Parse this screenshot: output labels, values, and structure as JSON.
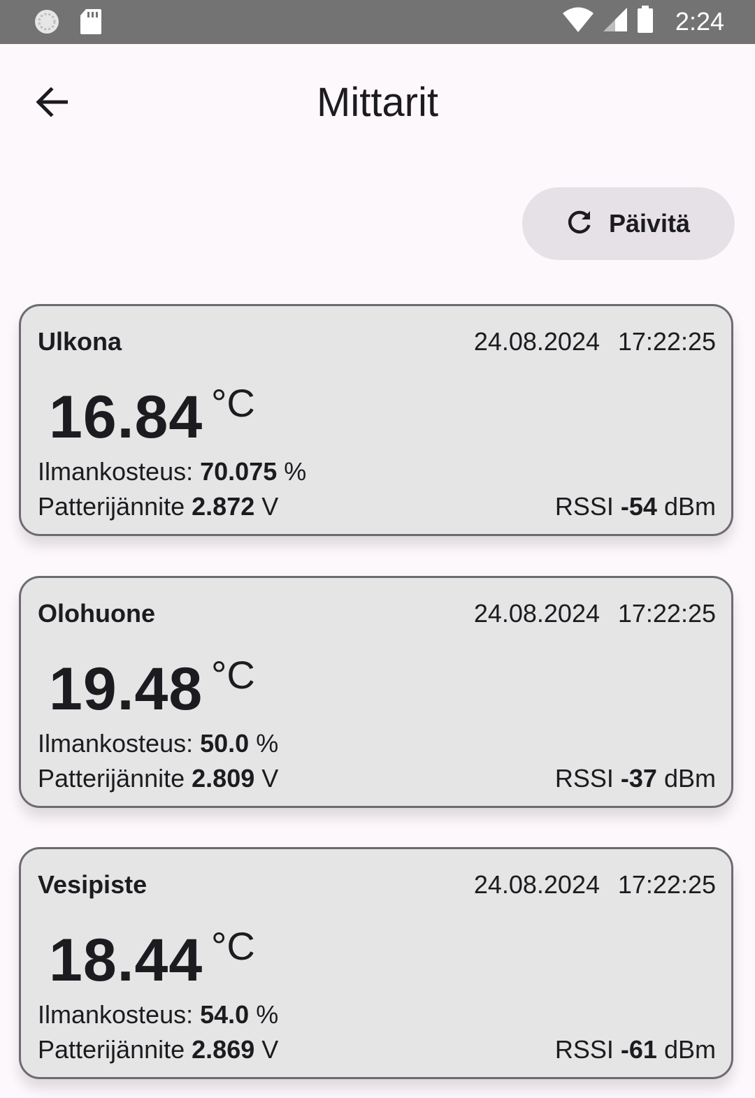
{
  "status_bar": {
    "time": "2:24",
    "icons": [
      "sync-icon",
      "sd-card-icon",
      "wifi-icon",
      "cell-signal-icon",
      "battery-icon"
    ]
  },
  "app_bar": {
    "title": "Mittarit",
    "back_icon": "arrow-back-icon"
  },
  "refresh_button": {
    "label": "Päivitä",
    "icon": "refresh-icon"
  },
  "labels": {
    "humidity_prefix": "Ilmankosteus:",
    "humidity_unit": "%",
    "battery_prefix": "Patterijännite",
    "battery_unit": "V",
    "rssi_prefix": "RSSI",
    "rssi_unit": "dBm",
    "temp_unit": "°C"
  },
  "sensors": [
    {
      "name": "Ulkona",
      "date": "24.08.2024",
      "time": "17:22:25",
      "temperature": "16.84",
      "humidity": "70.075",
      "battery": "2.872",
      "rssi": "-54"
    },
    {
      "name": "Olohuone",
      "date": "24.08.2024",
      "time": "17:22:25",
      "temperature": "19.48",
      "humidity": "50.0",
      "battery": "2.809",
      "rssi": "-37"
    },
    {
      "name": "Vesipiste",
      "date": "24.08.2024",
      "time": "17:22:25",
      "temperature": "18.44",
      "humidity": "54.0",
      "battery": "2.869",
      "rssi": "-61"
    }
  ]
}
